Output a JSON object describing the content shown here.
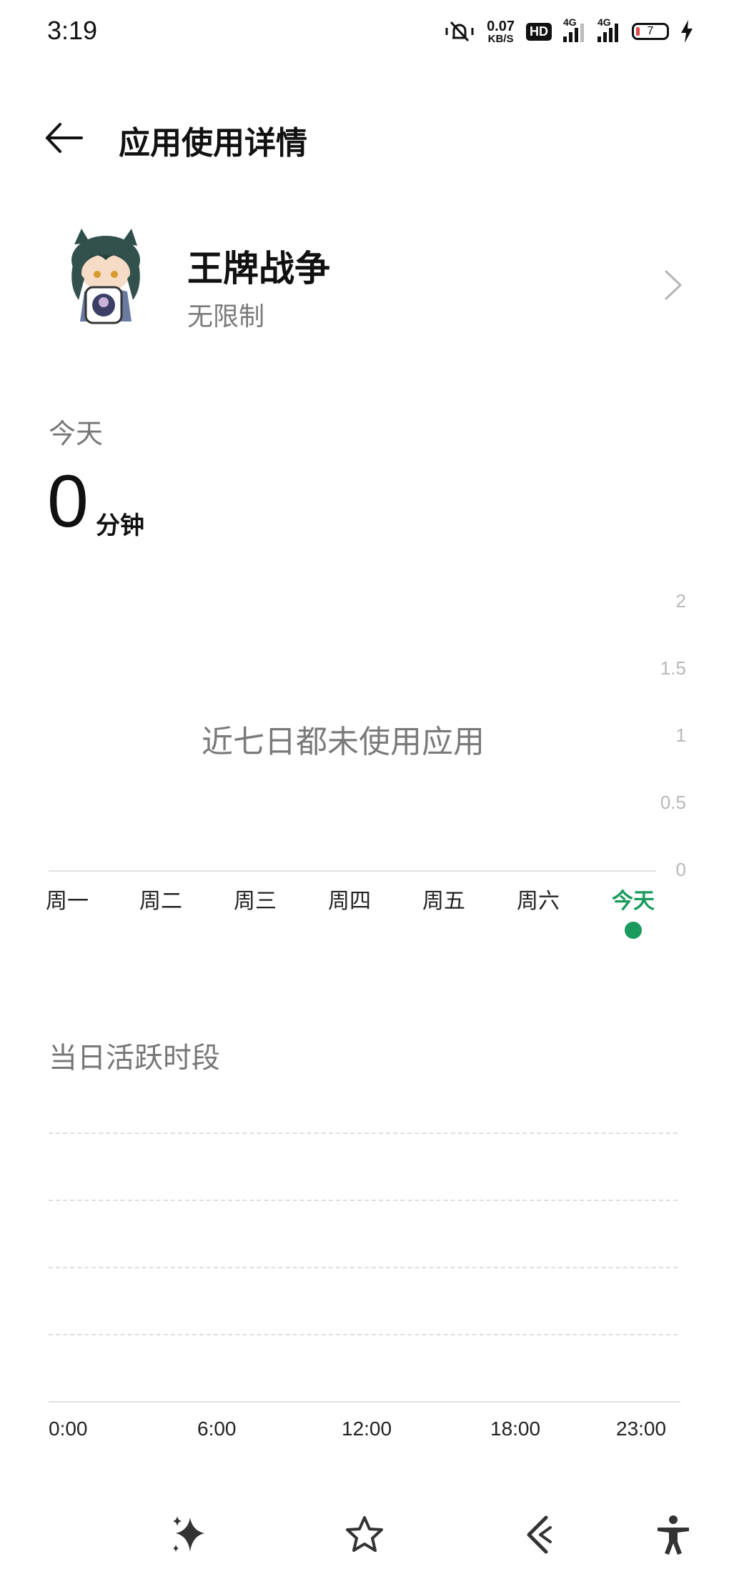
{
  "status_bar": {
    "time": "3:19",
    "net_speed_value": "0.07",
    "net_speed_unit": "KB/S",
    "hd_label": "HD",
    "signal1_label": "4G",
    "signal2_label": "4G",
    "battery_level": "7",
    "icons": [
      "mute-vibrate-icon",
      "signal-icon",
      "battery-icon",
      "charging-icon"
    ]
  },
  "header": {
    "title": "应用使用详情"
  },
  "app": {
    "name": "王牌战争",
    "limit": "无限制"
  },
  "summary": {
    "label": "今天",
    "value": "0",
    "unit": "分钟"
  },
  "weekly_chart": {
    "empty_message": "近七日都未使用应用",
    "y_ticks": [
      "2",
      "1.5",
      "1",
      "0.5",
      "0"
    ],
    "days": [
      "周一",
      "周二",
      "周三",
      "周四",
      "周五",
      "周六",
      "今天"
    ],
    "active_day": "今天",
    "accent_color": "#1a9a5c"
  },
  "active_hours": {
    "title": "当日活跃时段",
    "x_ticks": [
      "0:00",
      "6:00",
      "12:00",
      "18:00",
      "23:00"
    ]
  },
  "dock": {
    "icons": [
      "sparkle-icon",
      "star-icon",
      "back-nav-icon",
      "accessibility-icon"
    ]
  }
}
